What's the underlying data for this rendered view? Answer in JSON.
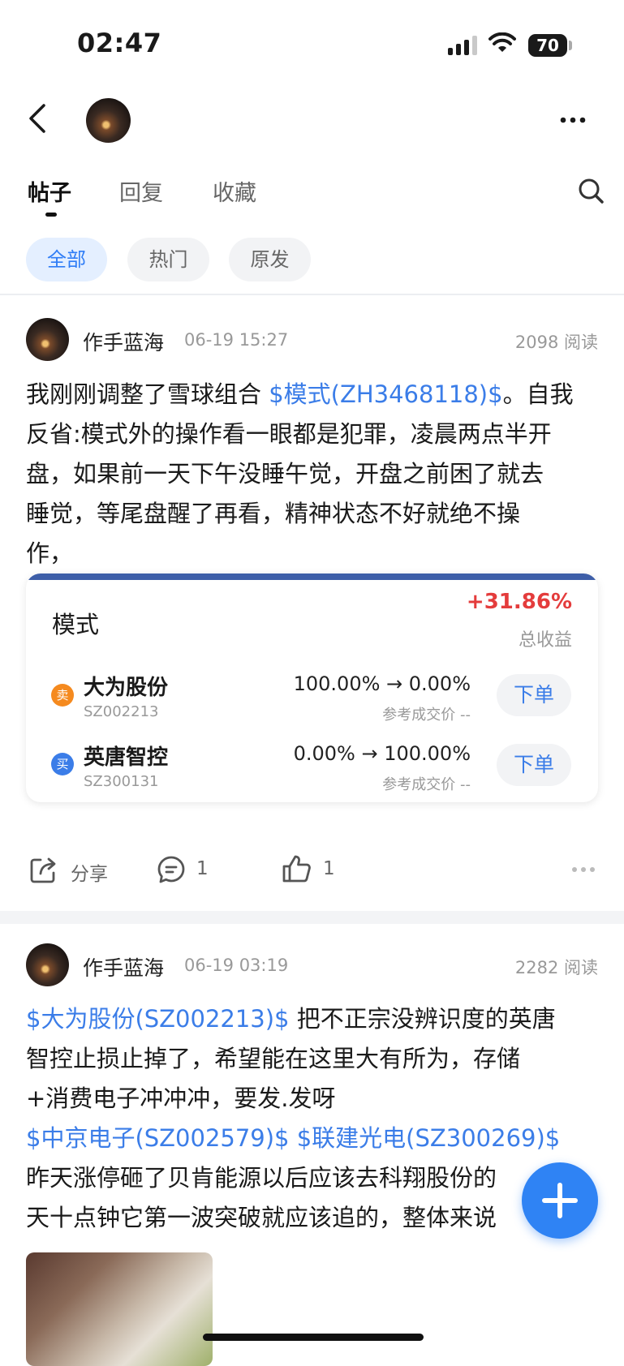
{
  "status_bar": {
    "time": "02:47",
    "battery": "70"
  },
  "tabs": [
    {
      "label": "帖子",
      "active": true
    },
    {
      "label": "回复",
      "active": false
    },
    {
      "label": "收藏",
      "active": false
    }
  ],
  "filters": [
    {
      "label": "全部",
      "active": true
    },
    {
      "label": "热门",
      "active": false
    },
    {
      "label": "原发",
      "active": false
    }
  ],
  "posts": [
    {
      "author": "作手蓝海",
      "date": "06-19 15:27",
      "reads": "2098 阅读",
      "text_lines": [
        {
          "pre": "我刚刚调整了雪球组合 ",
          "link": "$模式(ZH3468118)$",
          "post": "。自我"
        },
        {
          "pre": "反省:模式外的操作看一眼都是犯罪，凌晨两点半开",
          "link": "",
          "post": ""
        },
        {
          "pre": "盘，如果前一天下午没睡午觉，开盘之前困了就去",
          "link": "",
          "post": ""
        },
        {
          "pre": "睡觉，等尾盘醒了再看，精神状态不好就绝不操",
          "link": "",
          "post": ""
        },
        {
          "pre": "作，",
          "link": "",
          "post": ""
        }
      ],
      "portfolio": {
        "name": "模式",
        "gain": "+31.86%",
        "gain_label": "总收益",
        "trades": [
          {
            "badge": "卖",
            "badge_color": "#f58a1f",
            "name": "大为股份",
            "code": "SZ002213",
            "change": "100.00% → 0.00%",
            "ref": "参考成交价 --",
            "button": "下单"
          },
          {
            "badge": "买",
            "badge_color": "#3b7de8",
            "name": "英唐智控",
            "code": "SZ300131",
            "change": "0.00% → 100.00%",
            "ref": "参考成交价 --",
            "button": "下单"
          }
        ]
      },
      "actions": {
        "share": "分享",
        "comments": "1",
        "likes": "1"
      }
    },
    {
      "author": "作手蓝海",
      "date": "06-19 03:19",
      "reads": "2282 阅读",
      "text_lines": [
        {
          "link": "$大为股份(SZ002213)$",
          "post": " 把不正宗没辨识度的英唐"
        },
        {
          "link": "",
          "post": "智控止损止掉了，希望能在这里大有所为，存储"
        },
        {
          "link": "",
          "post": "+消费电子冲冲冲，要发.发呀"
        },
        {
          "link": "$中京电子(SZ002579)$ $联建光电(SZ300269)$",
          "post": ""
        },
        {
          "link": "",
          "post": "昨天涨停砸了贝肯能源以后应该去科翔股份的"
        },
        {
          "link": "",
          "post": "天十点钟它第一波突破就应该追的，整体来说"
        }
      ]
    }
  ]
}
